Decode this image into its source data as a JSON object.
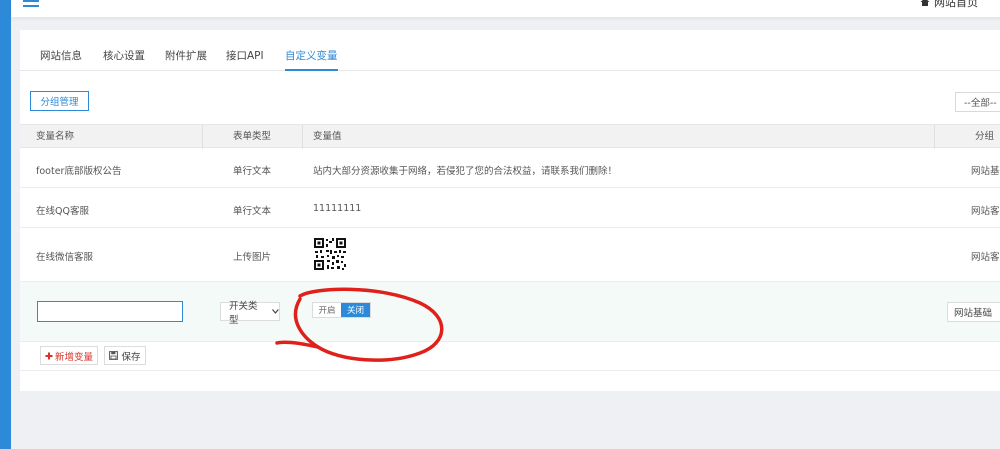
{
  "header": {
    "home_label": "网站首页",
    "icons": {
      "menu": "hamburger-icon",
      "home": "home-icon"
    },
    "accent_color": "#2c8ad8"
  },
  "tabs": [
    {
      "label": "网站信息",
      "active": false
    },
    {
      "label": "核心设置",
      "active": false
    },
    {
      "label": "附件扩展",
      "active": false
    },
    {
      "label": "接口API",
      "active": false
    },
    {
      "label": "自定义变量",
      "active": true
    }
  ],
  "toolbar": {
    "group_manage_label": "分组管理",
    "filter_value": "--全部--"
  },
  "table": {
    "headers": {
      "name": "变量名称",
      "type": "表单类型",
      "value": "变量值",
      "group": "分组"
    },
    "rows": [
      {
        "name": "footer底部版权公告",
        "type": "单行文本",
        "value": "站内大部分资源收集于网络，若侵犯了您的合法权益，请联系我们删除！",
        "group": "网站基础"
      },
      {
        "name": "在线QQ客服",
        "type": "单行文本",
        "value": "11111111",
        "group": "网站客服"
      },
      {
        "name": "在线微信客服",
        "type": "上传图片",
        "value_icon": "qr-code-icon",
        "group": "网站客服"
      }
    ]
  },
  "new_row": {
    "name_value": "",
    "type_value": "开关类型",
    "switch_on_label": "开启",
    "switch_off_label": "关闭",
    "switch_state": "off",
    "group_value": "网站基础"
  },
  "actions": {
    "add_label": "新增变量",
    "save_label": "保存",
    "add_color": "#d9312a"
  },
  "annotation": {
    "color": "#e0211b",
    "shape": "hand-drawn-circle"
  }
}
